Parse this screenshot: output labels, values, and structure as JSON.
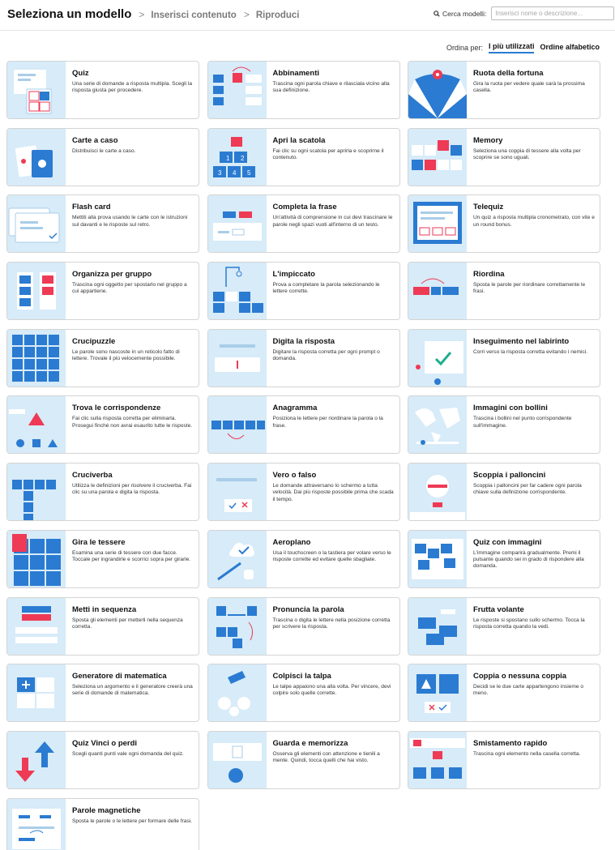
{
  "breadcrumb": {
    "step1": "Seleziona un modello",
    "step2": "Inserisci contenuto",
    "step3": "Riproduci",
    "separator": ">"
  },
  "search": {
    "label": "Cerca modelli:",
    "placeholder": "Inserisci nome o descrizione..."
  },
  "sort": {
    "label": "Ordina per:",
    "options": [
      "I più utilizzati",
      "Ordine alfabetico"
    ],
    "selected": "I più utilizzati"
  },
  "colors": {
    "thumb_bg": "#d7ebf8",
    "blue": "#2a7bd1",
    "red": "#ee3a55",
    "green": "#1fae8e"
  },
  "templates": [
    {
      "title": "Quiz",
      "desc": "Una serie di domande a risposta multipla. Scegli la risposta giusta per procedere.",
      "icon": "quiz-icon"
    },
    {
      "title": "Abbinamenti",
      "desc": "Trascina ogni parola chiave e rilasciala vicino alla sua definizione.",
      "icon": "match-up-icon"
    },
    {
      "title": "Ruota della fortuna",
      "desc": "Gira la ruota per vedere quale sarà la prossima casella.",
      "icon": "wheel-icon"
    },
    {
      "title": "Carte a caso",
      "desc": "Distribuisci le carte a caso.",
      "icon": "cards-icon"
    },
    {
      "title": "Apri la scatola",
      "desc": "Fai clic su ogni scatola per aprirla e scoprirne il contenuto.",
      "icon": "open-box-icon"
    },
    {
      "title": "Memory",
      "desc": "Seleziona una coppia di tessere alla volta per scoprire se sono uguali.",
      "icon": "memory-icon"
    },
    {
      "title": "Flash card",
      "desc": "Mettiti alla prova usando le carte con le istruzioni sul davanti e le risposte sul retro.",
      "icon": "flash-card-icon"
    },
    {
      "title": "Completa la frase",
      "desc": "Un'attività di comprensione in cui devi trascinare le parole negli spazi vuoti all'interno di un testo.",
      "icon": "complete-sentence-icon"
    },
    {
      "title": "Telequiz",
      "desc": "Un quiz a risposta multipla cronometrato, con vite e un round bonus.",
      "icon": "telequiz-icon"
    },
    {
      "title": "Organizza per gruppo",
      "desc": "Trascina ogni oggetto per spostarlo nel gruppo a cui appartiene.",
      "icon": "group-sort-icon"
    },
    {
      "title": "L'impiccato",
      "desc": "Prova a completare la parola selezionando le lettere corrette.",
      "icon": "hangman-icon"
    },
    {
      "title": "Riordina",
      "desc": "Sposta le parole per riordinare correttamente le frasi.",
      "icon": "unjumble-icon"
    },
    {
      "title": "Crucipuzzle",
      "desc": "Le parole sono nascoste in un reticolo fatto di lettere. Trovale il più velocemente possibile.",
      "icon": "wordsearch-icon"
    },
    {
      "title": "Digita la risposta",
      "desc": "Digitare la risposta corretta per ogni prompt o domanda.",
      "icon": "type-answer-icon"
    },
    {
      "title": "Inseguimento nel labirinto",
      "desc": "Corri verso la risposta corretta evitando i nemici.",
      "icon": "maze-chase-icon"
    },
    {
      "title": "Trova le corrispondenze",
      "desc": "Fai clic sulla risposta corretta per eliminarla. Prosegui finché non avrai esaurito tutte le risposte.",
      "icon": "find-match-icon"
    },
    {
      "title": "Anagramma",
      "desc": "Posiziona le lettere per riordinare la parola o la frase.",
      "icon": "anagram-icon"
    },
    {
      "title": "Immagini con bollini",
      "desc": "Trascina i bollini nel punto corrispondente sull'immagine.",
      "icon": "labelled-diagram-icon"
    },
    {
      "title": "Cruciverba",
      "desc": "Utilizza le definizioni per risolvere il cruciverba. Fai clic su una parola e digita la risposta.",
      "icon": "crossword-icon"
    },
    {
      "title": "Vero o falso",
      "desc": "Le domande attraversano lo schermo a tutta velocità. Dai più risposte possibile prima che scada il tempo.",
      "icon": "true-false-icon"
    },
    {
      "title": "Scoppia i palloncini",
      "desc": "Scoppia i palloncini per far cadere ogni parola chiave sulla definizione corrispondente.",
      "icon": "balloon-pop-icon"
    },
    {
      "title": "Gira le tessere",
      "desc": "Esamina una serie di tessere con due facce. Toccale per ingrandirle e scorrici sopra per girarle.",
      "icon": "flip-tiles-icon"
    },
    {
      "title": "Aeroplano",
      "desc": "Usa il touchscreen o la tastiera per volare verso le risposte corrette ed evitare quelle sbagliate.",
      "icon": "airplane-icon"
    },
    {
      "title": "Quiz con immagini",
      "desc": "L'immagine comparirà gradualmente. Premi il pulsante quando sei in grado di rispondere alla domanda.",
      "icon": "image-quiz-icon"
    },
    {
      "title": "Metti in sequenza",
      "desc": "Sposta gli elementi per metterli nella sequenza corretta.",
      "icon": "rank-order-icon"
    },
    {
      "title": "Pronuncia la parola",
      "desc": "Trascina o digita le lettere nella posizione corretta per scrivere la risposta.",
      "icon": "spell-word-icon"
    },
    {
      "title": "Frutta volante",
      "desc": "Le risposte si spostano sullo schermo. Tocca la risposta corretta quando la vedi.",
      "icon": "flying-fruit-icon"
    },
    {
      "title": "Generatore di matematica",
      "desc": "Seleziona un argomento e il generatore creerà una serie di domande di matematica.",
      "icon": "math-generator-icon"
    },
    {
      "title": "Colpisci la talpa",
      "desc": "Le talpe appaiono una alla volta. Per vincere, devi colpire solo quelle corrette.",
      "icon": "whack-a-mole-icon"
    },
    {
      "title": "Coppia o nessuna coppia",
      "desc": "Decidi se le due carte appartengono insieme o meno.",
      "icon": "match-no-match-icon"
    },
    {
      "title": "Quiz Vinci o perdi",
      "desc": "Scegli quanti punti vale ogni domanda del quiz.",
      "icon": "win-lose-quiz-icon"
    },
    {
      "title": "Guarda e memorizza",
      "desc": "Osserva gli elementi con attenzione e tienili a mente. Quindi, tocca quelli che hai visto.",
      "icon": "watch-memorize-icon"
    },
    {
      "title": "Smistamento rapido",
      "desc": "Trascina ogni elemento nella casella corretta.",
      "icon": "speed-sorting-icon"
    },
    {
      "title": "Parole magnetiche",
      "desc": "Sposta le parole o le lettere per formare delle frasi.",
      "icon": "magnetic-words-icon"
    }
  ]
}
